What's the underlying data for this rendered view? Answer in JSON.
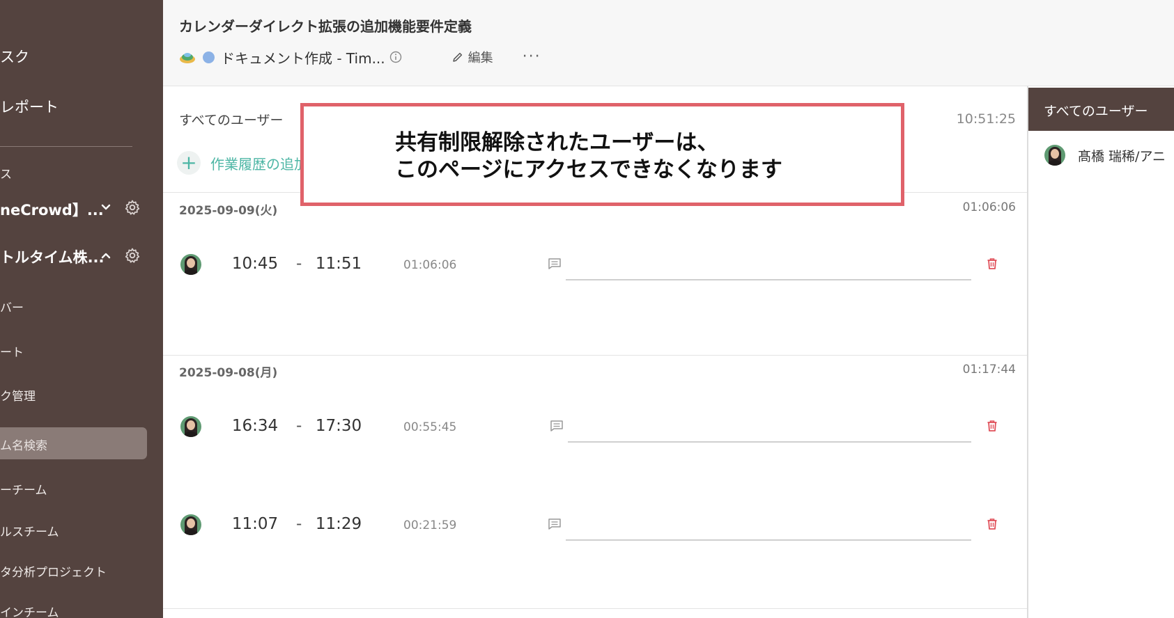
{
  "sidebar": {
    "items": [
      {
        "label": "スク"
      },
      {
        "label": "レポート"
      },
      {
        "label": "ス"
      },
      {
        "label": "neCrowd】..."
      },
      {
        "label": "トルタイム株..."
      },
      {
        "label": "バー"
      },
      {
        "label": "ート"
      },
      {
        "label": "ク管理"
      },
      {
        "label": "ーチーム"
      },
      {
        "label": "ルスチーム"
      },
      {
        "label": "タ分析プロジェクト"
      },
      {
        "label": "インチーム"
      }
    ],
    "search_placeholder": "ム名検索"
  },
  "header": {
    "title": "カレンダーダイレクト拡張の追加機能要件定義",
    "doc_name": "ドキュメント作成 - Tim...",
    "edit_label": "編集",
    "more_label": "···"
  },
  "main": {
    "all_users_label": "すべてのユーザー",
    "total_time": "10:51:25",
    "add_history_label": "作業履歴の追加",
    "days": [
      {
        "date": "2025-09-09(火)",
        "total": "01:06:06",
        "entries": [
          {
            "start": "10:45",
            "end": "11:51",
            "duration": "01:06:06"
          }
        ]
      },
      {
        "date": "2025-09-08(月)",
        "total": "01:17:44",
        "entries": [
          {
            "start": "16:34",
            "end": "17:30",
            "duration": "00:55:45"
          },
          {
            "start": "11:07",
            "end": "11:29",
            "duration": "00:21:59"
          }
        ]
      }
    ],
    "dash": "-"
  },
  "right_panel": {
    "header": "すべてのユーザー",
    "user_name": "髙橋 瑞稀/アニ"
  },
  "notice": {
    "line1": "共有制限解除されたユーザーは、",
    "line2": "このページにアクセスできなくなります"
  },
  "colors": {
    "sidebar_bg": "#54433f",
    "accent_teal": "#4db6a5",
    "delete_red": "#e0505a",
    "notice_border": "#e0626a"
  }
}
